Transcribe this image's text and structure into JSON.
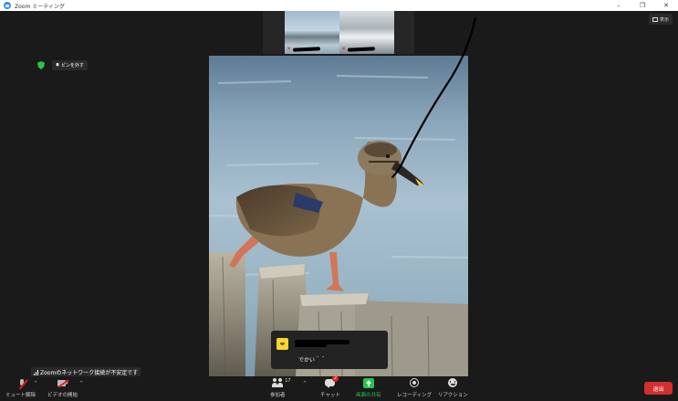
{
  "window": {
    "title": "Zoom ミーティング",
    "controls": {
      "minimize": "–",
      "maximize": "❐",
      "close": "✕"
    }
  },
  "view_button": {
    "label": "表示",
    "icon": "grid-icon"
  },
  "security_icon": "shield-icon",
  "pin_badge": {
    "label": "ピンを外す",
    "icon": "pin-icon"
  },
  "thumbnails": [
    {
      "muted": true,
      "name_hidden": true
    },
    {
      "muted": true,
      "name_hidden": true
    }
  ],
  "chat_popup": {
    "message": "でかい＾＾",
    "sender_hidden": true
  },
  "network_notice": {
    "text": "Zoomのネットワーク接続が不安定です"
  },
  "toolbar": {
    "mute": {
      "label": "ミュート解除",
      "caret": "^"
    },
    "video": {
      "label": "ビデオの開始",
      "caret": "^"
    },
    "participants": {
      "label": "参加者",
      "count": "17",
      "caret": "^"
    },
    "chat": {
      "label": "チャット",
      "badge": "2"
    },
    "share": {
      "label": "画面の共有"
    },
    "record": {
      "label": "レコーディング"
    },
    "reactions": {
      "label": "リアクション"
    },
    "leave": {
      "label": "退出"
    }
  },
  "colors": {
    "background": "#1a1a1a",
    "accent_green": "#26c64b",
    "leave_red": "#d32f2f",
    "badge_red": "#e02020",
    "zoom_blue": "#2d8cff"
  }
}
